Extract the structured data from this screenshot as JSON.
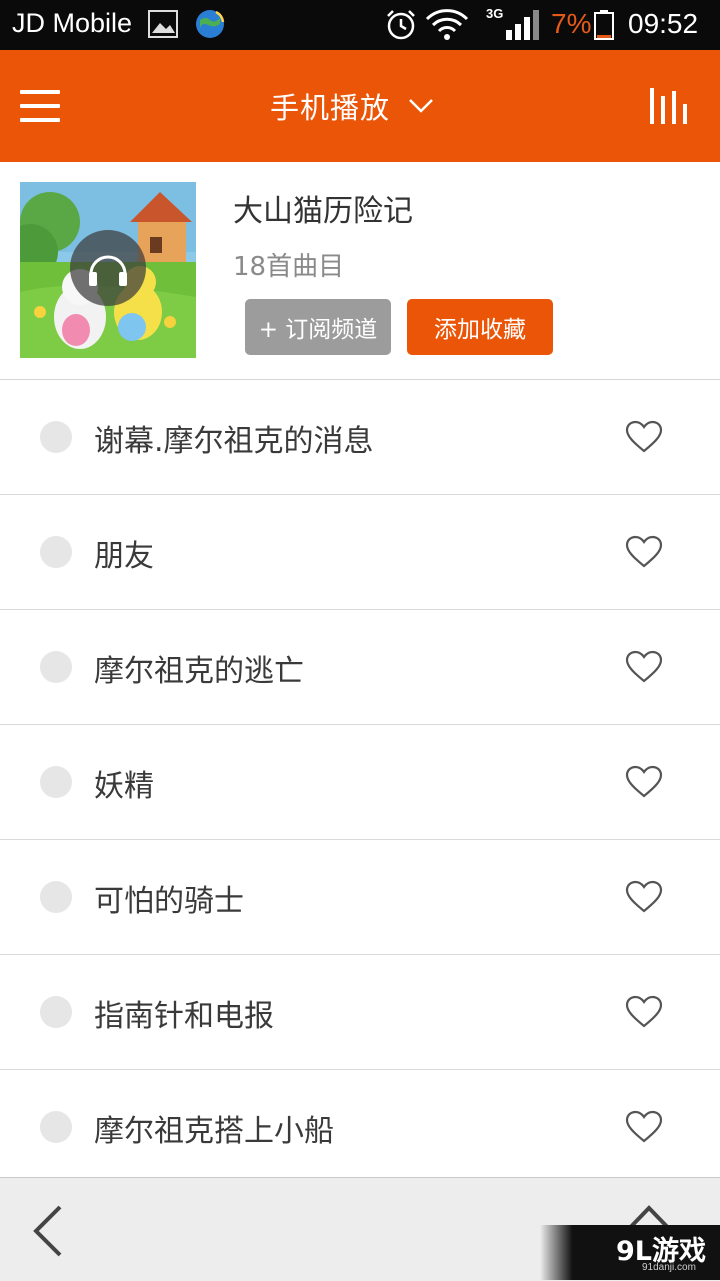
{
  "status_bar": {
    "carrier": "JD Mobile",
    "network_type": "3G",
    "battery_percent": "7%",
    "time": "09:52",
    "icons": [
      "image-icon",
      "globe-sync-icon",
      "alarm-icon",
      "wifi-icon",
      "signal-icon",
      "battery-icon"
    ],
    "battery_color": "#e65a17"
  },
  "app_bar": {
    "title": "手机播放",
    "accent_color": "#eb5507",
    "icons": [
      "menu-icon",
      "chevron-down-icon",
      "equalizer-icon"
    ]
  },
  "album": {
    "title": "大山猫历险记",
    "track_count": "18首曲目",
    "subscribe_label": "+ 订阅频道",
    "favorite_label": "添加收藏",
    "cover_icon": "headphones-icon"
  },
  "tracks": [
    {
      "title": "谢幕.摩尔祖克的消息"
    },
    {
      "title": "朋友"
    },
    {
      "title": "摩尔祖克的逃亡"
    },
    {
      "title": "妖精"
    },
    {
      "title": "可怕的骑士"
    },
    {
      "title": "指南针和电报"
    },
    {
      "title": "摩尔祖克搭上小船"
    }
  ],
  "bottom_bar": {
    "icons": [
      "back-arrow-icon",
      "chevron-up-icon"
    ]
  },
  "watermark": {
    "logo": "9L游戏",
    "domain": "91danji.com"
  }
}
